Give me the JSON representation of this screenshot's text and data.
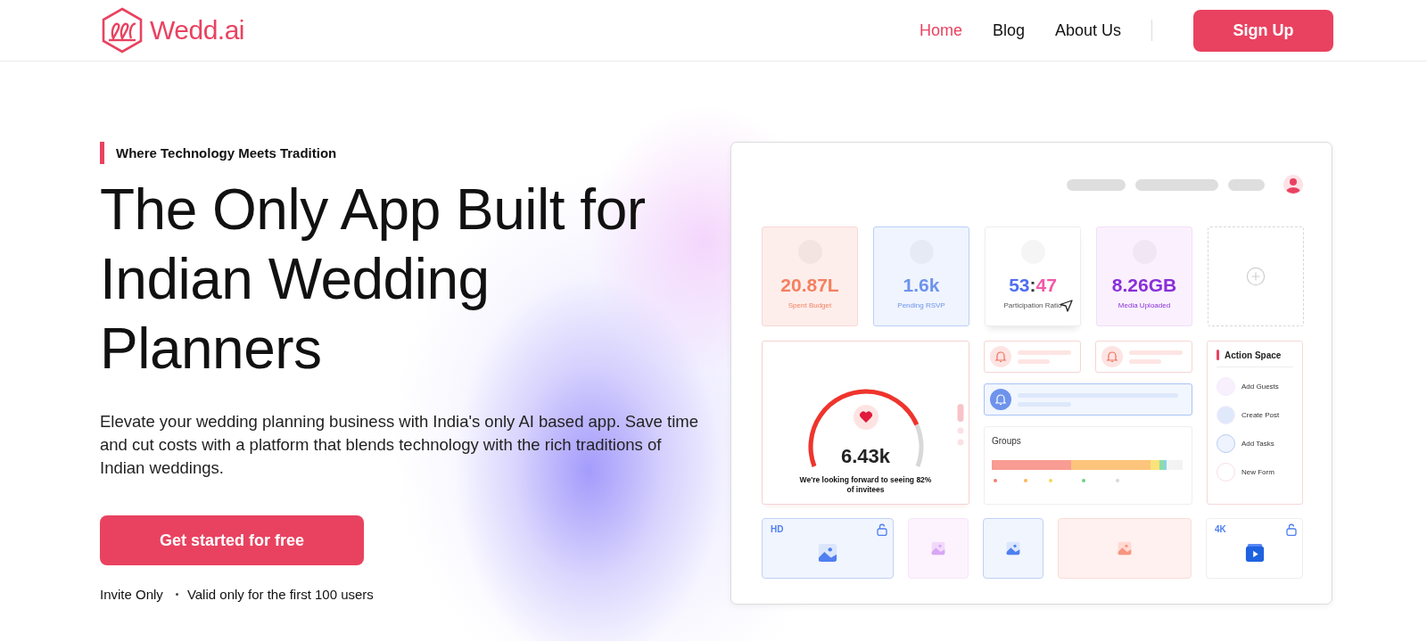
{
  "brand": {
    "name": "Wedd.ai"
  },
  "nav": {
    "links": [
      {
        "label": "Home",
        "selected": true
      },
      {
        "label": "Blog",
        "selected": false
      },
      {
        "label": "About Us",
        "selected": false
      }
    ],
    "cta": "Sign Up"
  },
  "hero": {
    "tagline": "Where Technology Meets Tradition",
    "heading": "The Only App Built for Indian Wedding Planners",
    "description": "Elevate your wedding planning business with India's only AI based app. Save time and cut costs with a platform that blends technology with the rich traditions of Indian weddings.",
    "button": "Get started for free",
    "notes": [
      "Invite Only",
      "Valid only for the first 100 users"
    ]
  },
  "dashboard": {
    "stats": [
      {
        "kind": "metric",
        "parts": [
          {
            "text": "20.87L",
            "color": "#f5805f"
          }
        ],
        "label": "Spent Budget",
        "color": "#fdeeec"
      },
      {
        "kind": "metric",
        "parts": [
          {
            "text": "1.6k",
            "color": "#6e93ec"
          }
        ],
        "label": "Pending RSVP",
        "color": "#eff4fe"
      },
      {
        "kind": "ratio",
        "parts": [
          {
            "text": "53",
            "color": "#4f6ef0"
          },
          {
            "text": ":",
            "color": "#333333"
          },
          {
            "text": "47",
            "color": "#f257a8"
          }
        ],
        "label": "Participation Ratio",
        "color": "#ffffff"
      },
      {
        "kind": "metric",
        "parts": [
          {
            "text": "8.26GB",
            "color": "#8a2fd8"
          }
        ],
        "label": "Media Uploaded",
        "color": "#fbf1fe"
      },
      {
        "kind": "add",
        "color": "#ffffff"
      }
    ],
    "gauge": {
      "value": "6.43k",
      "caption": "We're looking forward to seeing 82% of invitees"
    },
    "groups": {
      "title": "Groups"
    },
    "actions": {
      "title": "Action Space",
      "items": [
        {
          "label": "Add Guests",
          "color": "#f8f0fd"
        },
        {
          "label": "Create Post",
          "color": "#dfe9fb"
        },
        {
          "label": "Add Tasks",
          "color": "#eef3fd"
        },
        {
          "label": "New Form",
          "color": "#ffffff"
        }
      ]
    },
    "tiles": [
      {
        "kind": "image",
        "badge": "HD",
        "locked": true,
        "color": "#f1f5fe"
      },
      {
        "kind": "image",
        "color": "#fdf3fe"
      },
      {
        "kind": "image",
        "color": "#f1f5fe"
      },
      {
        "kind": "image",
        "color": "#fff1ef"
      },
      {
        "kind": "video",
        "badge": "4K",
        "locked": true,
        "color": "#ffffff"
      }
    ]
  }
}
